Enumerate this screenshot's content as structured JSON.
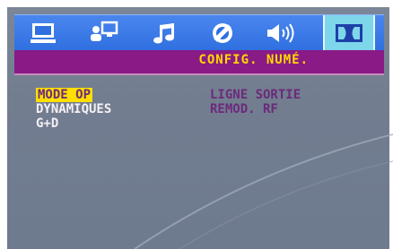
{
  "menu": {
    "tabs": [
      {
        "name": "general",
        "icon": "monitor-icon"
      },
      {
        "name": "video",
        "icon": "person-screen-icon"
      },
      {
        "name": "audio",
        "icon": "music-note-icon"
      },
      {
        "name": "rating",
        "icon": "circle-slash-icon"
      },
      {
        "name": "speaker",
        "icon": "speaker-icon"
      },
      {
        "name": "digital",
        "icon": "dolby-icon"
      }
    ],
    "active_tab": "digital"
  },
  "title": "CONFIG. NUMÉ.",
  "options": {
    "left": [
      "MODE OP",
      "DYNAMIQUES",
      "G+D"
    ],
    "right": [
      "LIGNE SORTIE",
      "REMOD. RF"
    ]
  },
  "colors": {
    "menubar": "#3a78e6",
    "active_tab": "#7dd6ea",
    "titlebar": "#8a1a86",
    "title_text": "#ffd900",
    "selected_bg": "#ffdf00",
    "value_text": "#6b2a7a",
    "body_bg": "#76819a"
  }
}
